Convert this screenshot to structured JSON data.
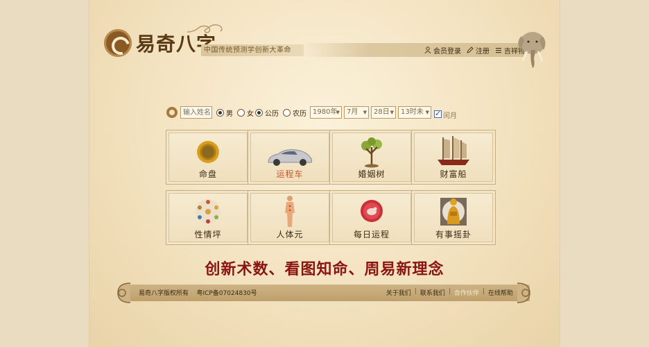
{
  "header": {
    "logo_text": "易奇八字",
    "slogan": "中国传统预测学创新大革命",
    "links": [
      {
        "label": "会员登录",
        "icon": "user-icon"
      },
      {
        "label": "注册",
        "icon": "pencil-icon"
      },
      {
        "label": "吉祥物",
        "icon": "list-icon"
      }
    ]
  },
  "form": {
    "name_placeholder": "输入姓名",
    "gender_male": "男",
    "gender_female": "女",
    "calendar_solar": "公历",
    "calendar_lunar": "农历",
    "year": "1980年",
    "month": "7月",
    "day": "28日",
    "hour": "13时未",
    "leap_month": "闰月"
  },
  "tiles": [
    {
      "label": "命盘",
      "icon": "sun-disc-icon",
      "highlight": false
    },
    {
      "label": "运程车",
      "icon": "car-icon",
      "highlight": true
    },
    {
      "label": "婚姻树",
      "icon": "tree-icon",
      "highlight": false
    },
    {
      "label": "财富船",
      "icon": "junk-ship-icon",
      "highlight": false
    },
    {
      "label": "性情坪",
      "icon": "bagua-circle-icon",
      "highlight": false
    },
    {
      "label": "人体元",
      "icon": "human-body-icon",
      "highlight": false
    },
    {
      "label": "每日运程",
      "icon": "zodiac-disc-icon",
      "highlight": false
    },
    {
      "label": "有事摇卦",
      "icon": "deity-statue-icon",
      "highlight": false
    }
  ],
  "tagline": "创新术数、看图知命、周易新理念",
  "footer": {
    "copyright": "易奇八字版权所有",
    "icp": "粤ICP备07024830号",
    "links": [
      "关于我们",
      "联系我们",
      "合作伙伴",
      "在线帮助"
    ]
  },
  "colors": {
    "accent_dark_red": "#8a1410",
    "brown_text": "#3a2a14",
    "highlight_orange": "#c8582a"
  }
}
